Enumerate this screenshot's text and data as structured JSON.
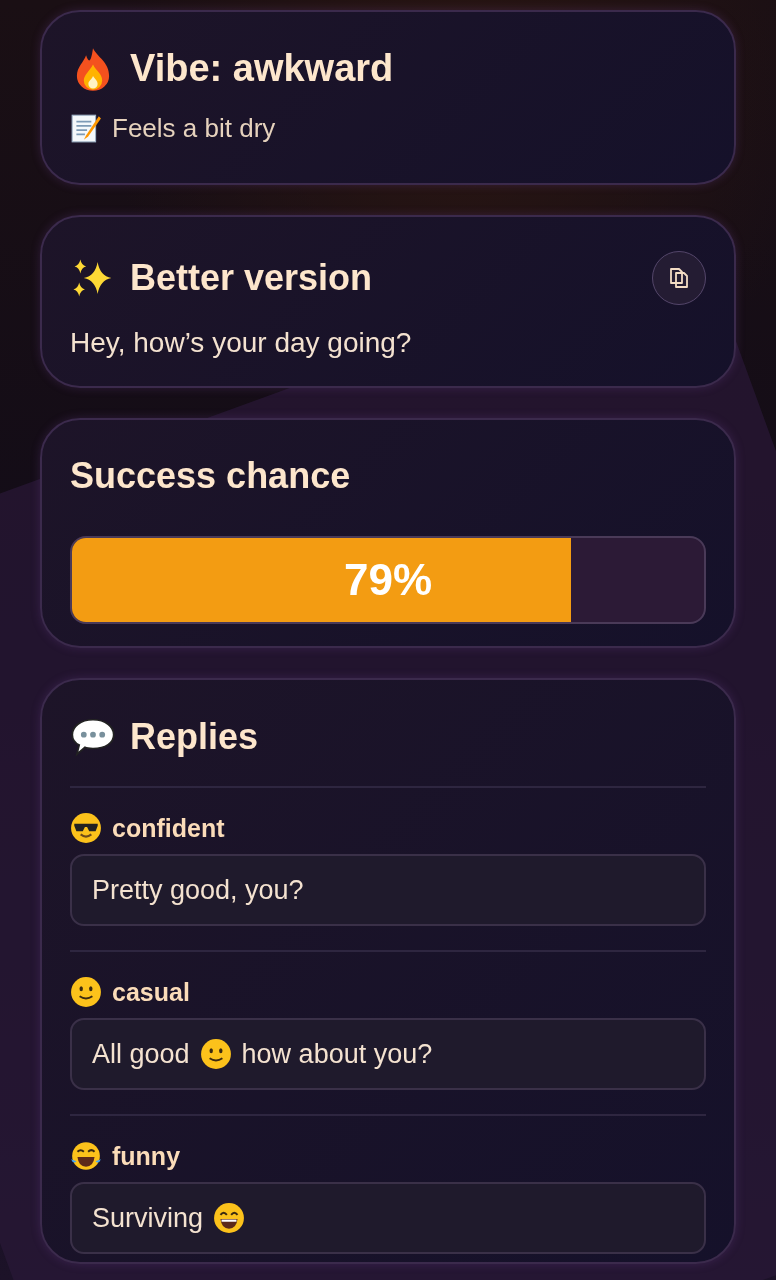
{
  "vibe": {
    "title": "Vibe: awkward",
    "note": "Feels a bit dry"
  },
  "better_version": {
    "title": "Better version",
    "text": "Hey, how’s your day going?"
  },
  "success": {
    "title": "Success chance",
    "level": 0.79,
    "reading": "79%"
  },
  "replies": {
    "title": "Replies",
    "items": [
      {
        "kind": "confident",
        "label": "confident",
        "parts": [
          {
            "kind": "text",
            "text": "Pretty good, you?"
          }
        ]
      },
      {
        "kind": "casual",
        "label": "casual",
        "parts": [
          {
            "kind": "text",
            "text": "All good"
          },
          {
            "kind": "smile"
          },
          {
            "kind": "text",
            "text": "how about you?"
          }
        ]
      },
      {
        "kind": "funny",
        "label": "funny",
        "parts": [
          {
            "kind": "text",
            "text": "Surviving"
          },
          {
            "kind": "grin"
          }
        ]
      }
    ]
  }
}
